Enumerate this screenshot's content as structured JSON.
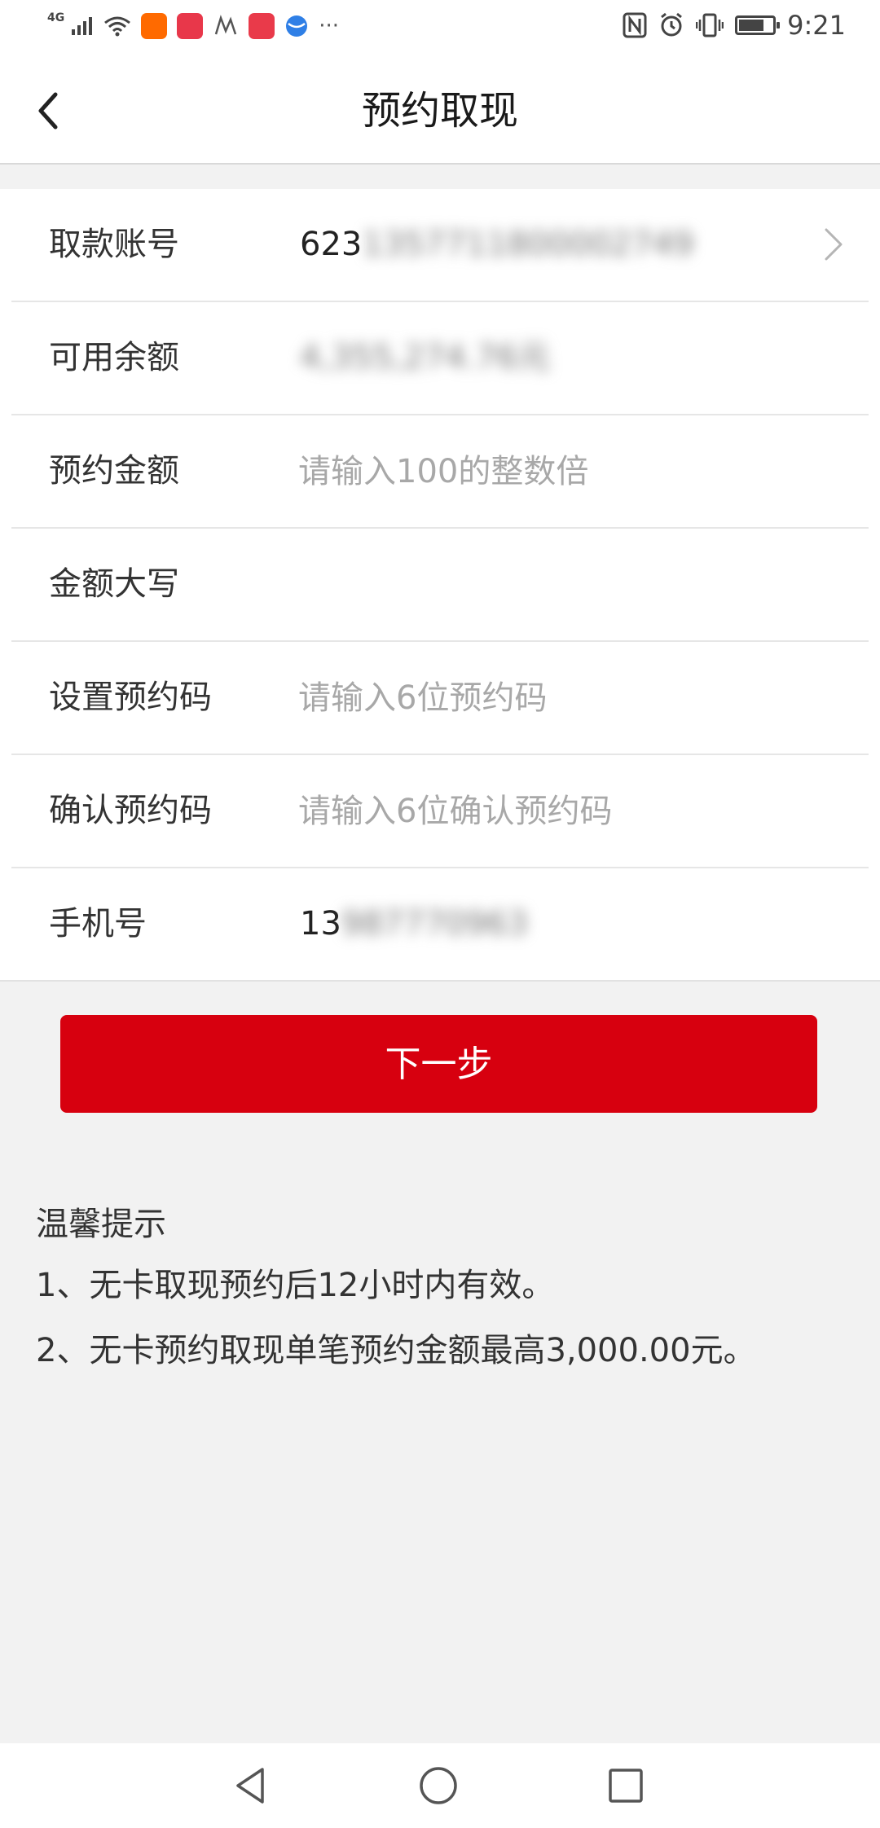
{
  "status_bar": {
    "network": "4G",
    "more": "···",
    "time": "9:21",
    "battery_level": 0.75
  },
  "header": {
    "title": "预约取现"
  },
  "form": {
    "account": {
      "label": "取款账号",
      "prefix": "623",
      "masked": "1357711800002749"
    },
    "balance": {
      "label": "可用余额",
      "masked": "4,355,274.76元"
    },
    "amount": {
      "label": "预约金额",
      "placeholder": "请输入100的整数倍"
    },
    "amount_upper": {
      "label": "金额大写"
    },
    "set_code": {
      "label": "设置预约码",
      "placeholder": "请输入6位预约码"
    },
    "confirm_code": {
      "label": "确认预约码",
      "placeholder": "请输入6位确认预约码"
    },
    "phone": {
      "label": "手机号",
      "prefix": "13",
      "masked": "987770963"
    }
  },
  "actions": {
    "next_label": "下一步"
  },
  "tips": {
    "title": "温馨提示",
    "items": [
      "1、无卡取现预约后12小时内有效。",
      "2、无卡预约取现单笔预约金额最高3,000.00元。"
    ]
  },
  "colors": {
    "accent": "#d7000f",
    "background": "#f2f2f2",
    "placeholder": "#a8a8a8"
  }
}
